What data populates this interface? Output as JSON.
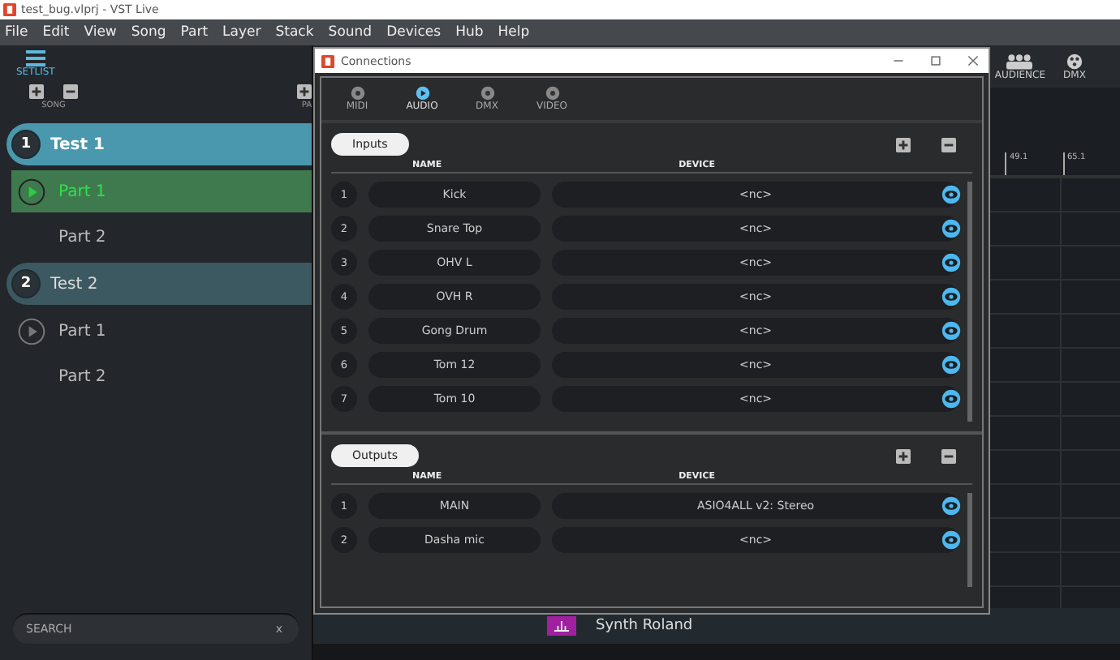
{
  "window": {
    "title": "test_bug.vlprj - VST Live"
  },
  "menu": [
    "File",
    "Edit",
    "View",
    "Song",
    "Part",
    "Layer",
    "Stack",
    "Sound",
    "Devices",
    "Hub",
    "Help"
  ],
  "sidebar": {
    "header": "SETLIST",
    "song_label": "SONG",
    "column_2_label": "PA",
    "songs": [
      {
        "number": "1",
        "title": "Test 1",
        "selected": true,
        "parts": [
          {
            "title": "Part 1",
            "selected": true,
            "play_button": true
          },
          {
            "title": "Part 2",
            "selected": false,
            "play_button": false
          }
        ]
      },
      {
        "number": "2",
        "title": "Test 2",
        "selected": false,
        "parts": [
          {
            "title": "Part 1",
            "selected": false,
            "play_button": true
          },
          {
            "title": "Part 2",
            "selected": false,
            "play_button": false
          }
        ]
      }
    ],
    "search": {
      "placeholder": "SEARCH",
      "clear": "x"
    }
  },
  "toolbar": [
    "AUDIENCE",
    "DMX"
  ],
  "timeline": {
    "markers": [
      "49.1",
      "65.1"
    ],
    "track": "Synth Roland"
  },
  "dialog": {
    "title": "Connections",
    "tabs": [
      {
        "label": "MIDI",
        "selected": false
      },
      {
        "label": "AUDIO",
        "selected": true
      },
      {
        "label": "DMX",
        "selected": false
      },
      {
        "label": "VIDEO",
        "selected": false
      }
    ],
    "sections": [
      {
        "title": "Inputs",
        "columns": [
          "NAME",
          "DEVICE"
        ],
        "rows": [
          {
            "number": "1",
            "name": "Kick",
            "device": "<nc>"
          },
          {
            "number": "2",
            "name": "Snare Top",
            "device": "<nc>"
          },
          {
            "number": "3",
            "name": "OHV L",
            "device": "<nc>"
          },
          {
            "number": "4",
            "name": "OVH R",
            "device": "<nc>"
          },
          {
            "number": "5",
            "name": "Gong Drum",
            "device": "<nc>"
          },
          {
            "number": "6",
            "name": "Tom 12",
            "device": "<nc>"
          },
          {
            "number": "7",
            "name": "Tom 10",
            "device": "<nc>"
          }
        ]
      },
      {
        "title": "Outputs",
        "columns": [
          "NAME",
          "DEVICE"
        ],
        "rows": [
          {
            "number": "1",
            "name": "MAIN",
            "device": "ASIO4ALL v2: Stereo"
          },
          {
            "number": "2",
            "name": "Dasha mic",
            "device": "<nc>"
          }
        ]
      }
    ]
  }
}
